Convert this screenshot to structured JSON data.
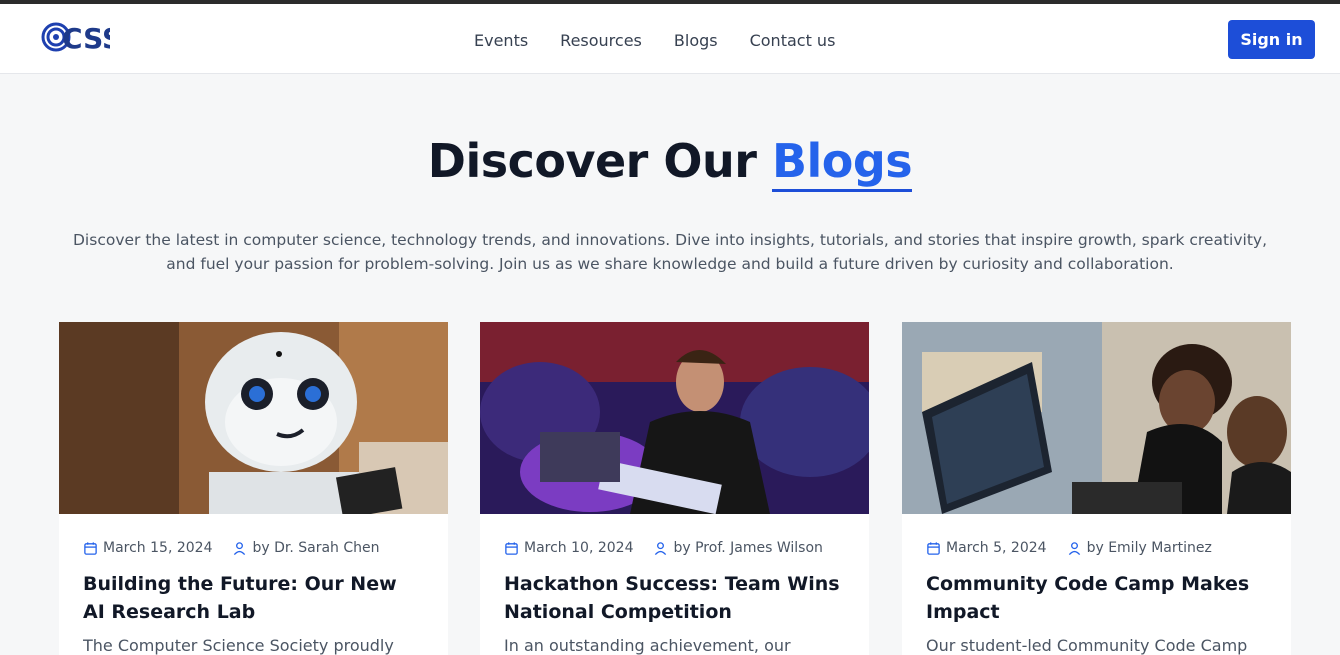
{
  "nav": {
    "logo_text": "CSS",
    "items": [
      {
        "label": "Events"
      },
      {
        "label": "Resources"
      },
      {
        "label": "Blogs"
      },
      {
        "label": "Contact us"
      }
    ],
    "signin_label": "Sign in"
  },
  "hero": {
    "title_prefix": "Discover Our ",
    "title_accent": "Blogs",
    "description": "Discover the latest in computer science, technology trends, and innovations. Dive into insights, tutorials, and stories that inspire growth, spark creativity, and fuel your passion for problem-solving. Join us as we share knowledge and build a future driven by curiosity and collaboration."
  },
  "blogs": [
    {
      "date": "March 15, 2024",
      "author": "by Dr. Sarah Chen",
      "title": "Building the Future: Our New AI Research Lab",
      "excerpt": "The Computer Science Society proudly"
    },
    {
      "date": "March 10, 2024",
      "author": "by Prof. James Wilson",
      "title": "Hackathon Success: Team Wins National Competition",
      "excerpt": "In an outstanding achievement, our"
    },
    {
      "date": "March 5, 2024",
      "author": "by Emily Martinez",
      "title": "Community Code Camp Makes Impact",
      "excerpt": "Our student-led Community Code Camp"
    }
  ],
  "colors": {
    "accent": "#2563eb",
    "button": "#1d4ed8"
  },
  "icons": {
    "date": "calendar-icon",
    "author": "user-icon"
  }
}
